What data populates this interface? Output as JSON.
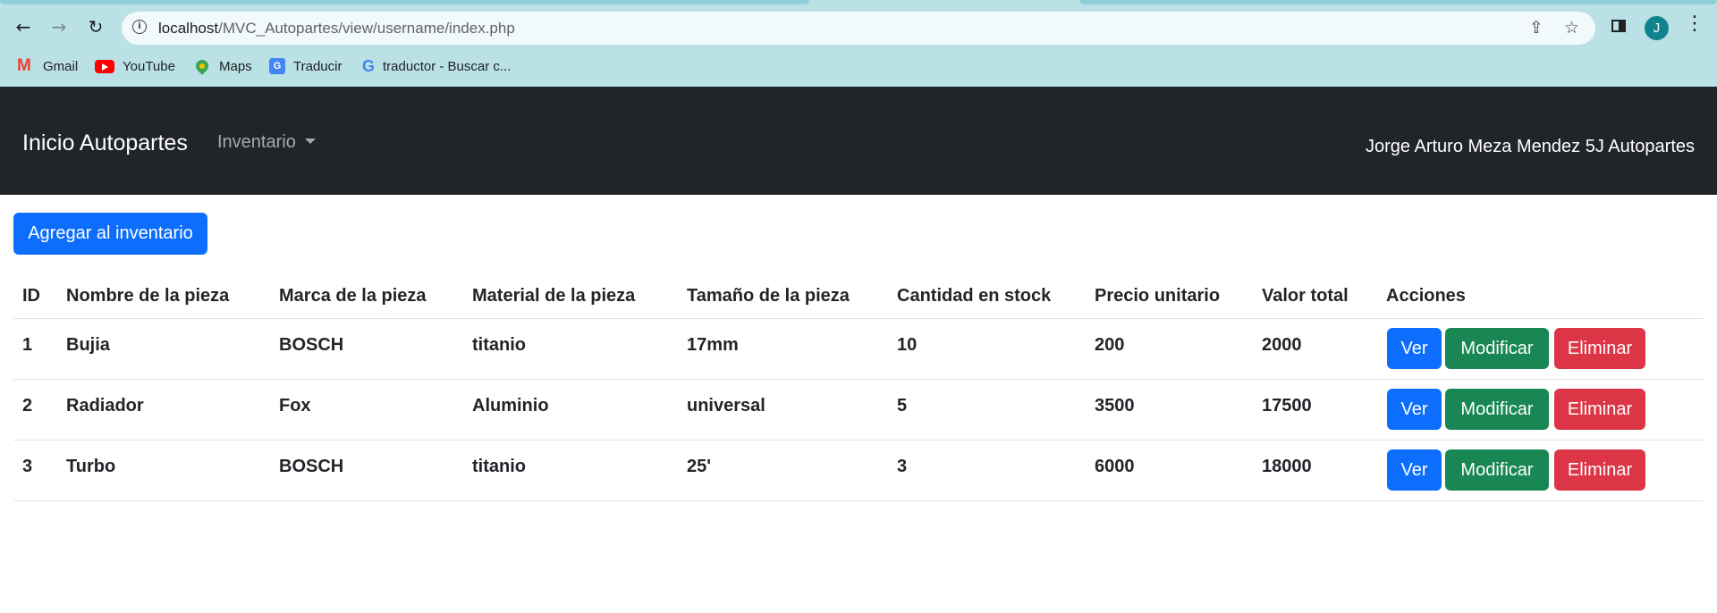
{
  "browser": {
    "url_host": "localhost",
    "url_path": "/MVC_Autopartes/view/username/index.php",
    "avatar_initial": "J",
    "bookmarks": [
      {
        "label": "Gmail",
        "icon": "gmail-icon"
      },
      {
        "label": "YouTube",
        "icon": "youtube-icon"
      },
      {
        "label": "Maps",
        "icon": "maps-icon"
      },
      {
        "label": "Traducir",
        "icon": "translate-icon"
      },
      {
        "label": "traductor - Buscar c...",
        "icon": "google-icon"
      }
    ],
    "colors": {
      "frame": "#b9e1e6",
      "omnibox": "#f1f9fa",
      "avatar": "#11838f"
    }
  },
  "navbar": {
    "brand": "Inicio Autopartes",
    "menu_label": "Inventario",
    "right_text": "Jorge Arturo Meza Mendez 5J Autopartes",
    "colors": {
      "background": "#212529",
      "brand": "#ffffff",
      "menu": "#a6a9ad"
    }
  },
  "main": {
    "add_button_label": "Agregar al inventario",
    "table": {
      "headers": [
        "ID",
        "Nombre de la pieza",
        "Marca de la pieza",
        "Material de la pieza",
        "Tamaño de la pieza",
        "Cantidad en stock",
        "Precio unitario",
        "Valor total",
        "Acciones"
      ],
      "rows": [
        [
          "1",
          "Bujia",
          "BOSCH",
          "titanio",
          "17mm",
          "10",
          "200",
          "2000"
        ],
        [
          "2",
          "Radiador",
          "Fox",
          "Aluminio",
          "universal",
          "5",
          "3500",
          "17500"
        ],
        [
          "3",
          "Turbo",
          "BOSCH",
          "titanio",
          "25'",
          "3",
          "6000",
          "18000"
        ]
      ],
      "actions": {
        "view": "Ver",
        "edit": "Modificar",
        "delete": "Eliminar"
      }
    },
    "colors": {
      "primary": "#0d6efd",
      "success": "#198754",
      "danger": "#dc3545"
    }
  }
}
